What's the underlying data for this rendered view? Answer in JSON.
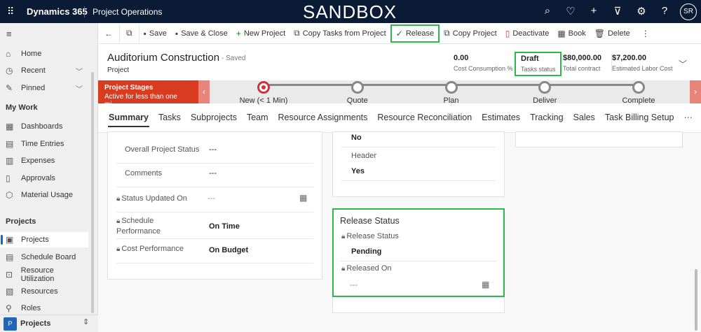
{
  "topbar": {
    "brand": "Dynamics 365",
    "app": "Project Operations",
    "environment": "SANDBOX",
    "user_initials": "SR",
    "icons": [
      "search-icon",
      "lightbulb-icon",
      "plus-icon",
      "filter-icon",
      "gear-icon",
      "help-icon"
    ]
  },
  "sidebar": {
    "items": [
      {
        "label": "Home",
        "icon": "home-icon"
      },
      {
        "label": "Recent",
        "icon": "clock-icon"
      },
      {
        "label": "Pinned",
        "icon": "pin-icon"
      }
    ],
    "my_work_title": "My Work",
    "my_work": [
      {
        "label": "Dashboards"
      },
      {
        "label": "Time Entries"
      },
      {
        "label": "Expenses"
      },
      {
        "label": "Approvals"
      },
      {
        "label": "Material Usage"
      }
    ],
    "projects_title": "Projects",
    "projects": [
      {
        "label": "Projects",
        "selected": true
      },
      {
        "label": "Schedule Board"
      },
      {
        "label": "Resource Utilization"
      },
      {
        "label": "Resources"
      },
      {
        "label": "Roles"
      }
    ],
    "area": {
      "badge": "P",
      "label": "Projects"
    }
  },
  "commands": {
    "save": "Save",
    "save_close": "Save & Close",
    "new_project": "New Project",
    "copy_tasks": "Copy Tasks from Project",
    "release": "Release",
    "copy_project": "Copy Project",
    "deactivate": "Deactivate",
    "book": "Book",
    "delete": "Delete"
  },
  "header": {
    "title": "Auditorium Construction",
    "saved": "- Saved",
    "entity": "Project",
    "kpis": [
      {
        "value": "0.00",
        "label": "Cost Consumption %"
      },
      {
        "value": "Draft",
        "label": "Tasks status"
      },
      {
        "value": "$80,000.00",
        "label": "Total contract"
      },
      {
        "value": "$7,200.00",
        "label": "Estimated Labor Cost"
      }
    ]
  },
  "stages": {
    "title": "Project Stages",
    "subtitle": "Active for less than one mi...",
    "items": [
      "New  (< 1 Min)",
      "Quote",
      "Plan",
      "Deliver",
      "Complete"
    ],
    "accent": "#d83b1f"
  },
  "tabs": [
    "Summary",
    "Tasks",
    "Subprojects",
    "Team",
    "Resource Assignments",
    "Resource Reconciliation",
    "Estimates",
    "Tracking",
    "Sales",
    "Task Billing Setup",
    "···"
  ],
  "summary": {
    "overall_status_label": "Overall Project Status",
    "overall_status": "---",
    "comments_label": "Comments",
    "comments": "---",
    "status_updated_label": "Status Updated On",
    "status_updated": "---",
    "schedule_perf_label": "Schedule Performance",
    "schedule_perf": "On Time",
    "cost_perf_label": "Cost Performance",
    "cost_perf": "On Budget"
  },
  "middle": {
    "top_value": "No",
    "header_label": "Header",
    "header_value": "Yes"
  },
  "release": {
    "section_title": "Release Status",
    "status_label": "Release Status",
    "status_value": "Pending",
    "released_on_label": "Released On",
    "released_on": "---",
    "highlight": "#2db84d"
  }
}
